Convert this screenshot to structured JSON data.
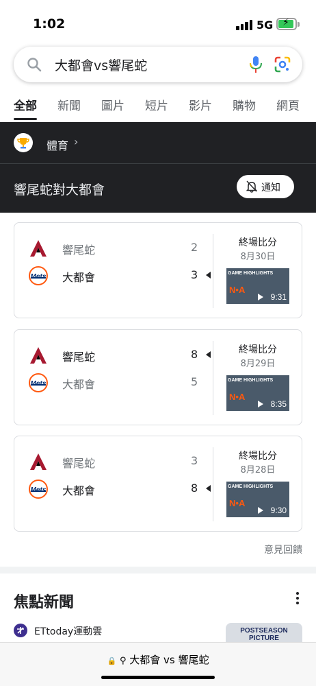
{
  "status": {
    "time": "1:02",
    "network": "5G"
  },
  "search": {
    "query": "大都會vs響尾蛇"
  },
  "tabs": [
    "全部",
    "新聞",
    "圖片",
    "短片",
    "影片",
    "購物",
    "網頁"
  ],
  "panel": {
    "category": "體育",
    "title": "響尾蛇對大都會",
    "notify_label": "通知"
  },
  "games": [
    {
      "teams": [
        {
          "name": "響尾蛇",
          "score": "2",
          "winner": false,
          "logo": "diamondbacks-logo"
        },
        {
          "name": "大都會",
          "score": "3",
          "winner": true,
          "logo": "mets-logo"
        }
      ],
      "status": "終場比分",
      "date": "8月30日",
      "video_duration": "9:31",
      "video_text": "GAME HIGHLIGHTS"
    },
    {
      "teams": [
        {
          "name": "響尾蛇",
          "score": "8",
          "winner": true,
          "logo": "diamondbacks-logo"
        },
        {
          "name": "大都會",
          "score": "5",
          "winner": false,
          "logo": "mets-logo"
        }
      ],
      "status": "終場比分",
      "date": "8月29日",
      "video_duration": "8:35",
      "video_text": "GAME HIGHLIGHTS"
    },
    {
      "teams": [
        {
          "name": "響尾蛇",
          "score": "3",
          "winner": false,
          "logo": "diamondbacks-logo"
        },
        {
          "name": "大都會",
          "score": "8",
          "winner": true,
          "logo": "mets-logo"
        }
      ],
      "status": "終場比分",
      "date": "8月28日",
      "video_duration": "9:30",
      "video_text": "GAME HIGHLIGHTS"
    }
  ],
  "feedback_label": "意見回饋",
  "news": {
    "heading": "焦點新聞",
    "source": "ETtoday運動雲",
    "thumb_text": "POSTSEASON PICTURE"
  },
  "bottom": {
    "url": "大都會 vs 響尾蛇"
  },
  "colors": {
    "mets_blue": "#002d72",
    "mets_orange": "#ff5910",
    "dbacks_red": "#a71930",
    "dark_panel": "#202124"
  }
}
